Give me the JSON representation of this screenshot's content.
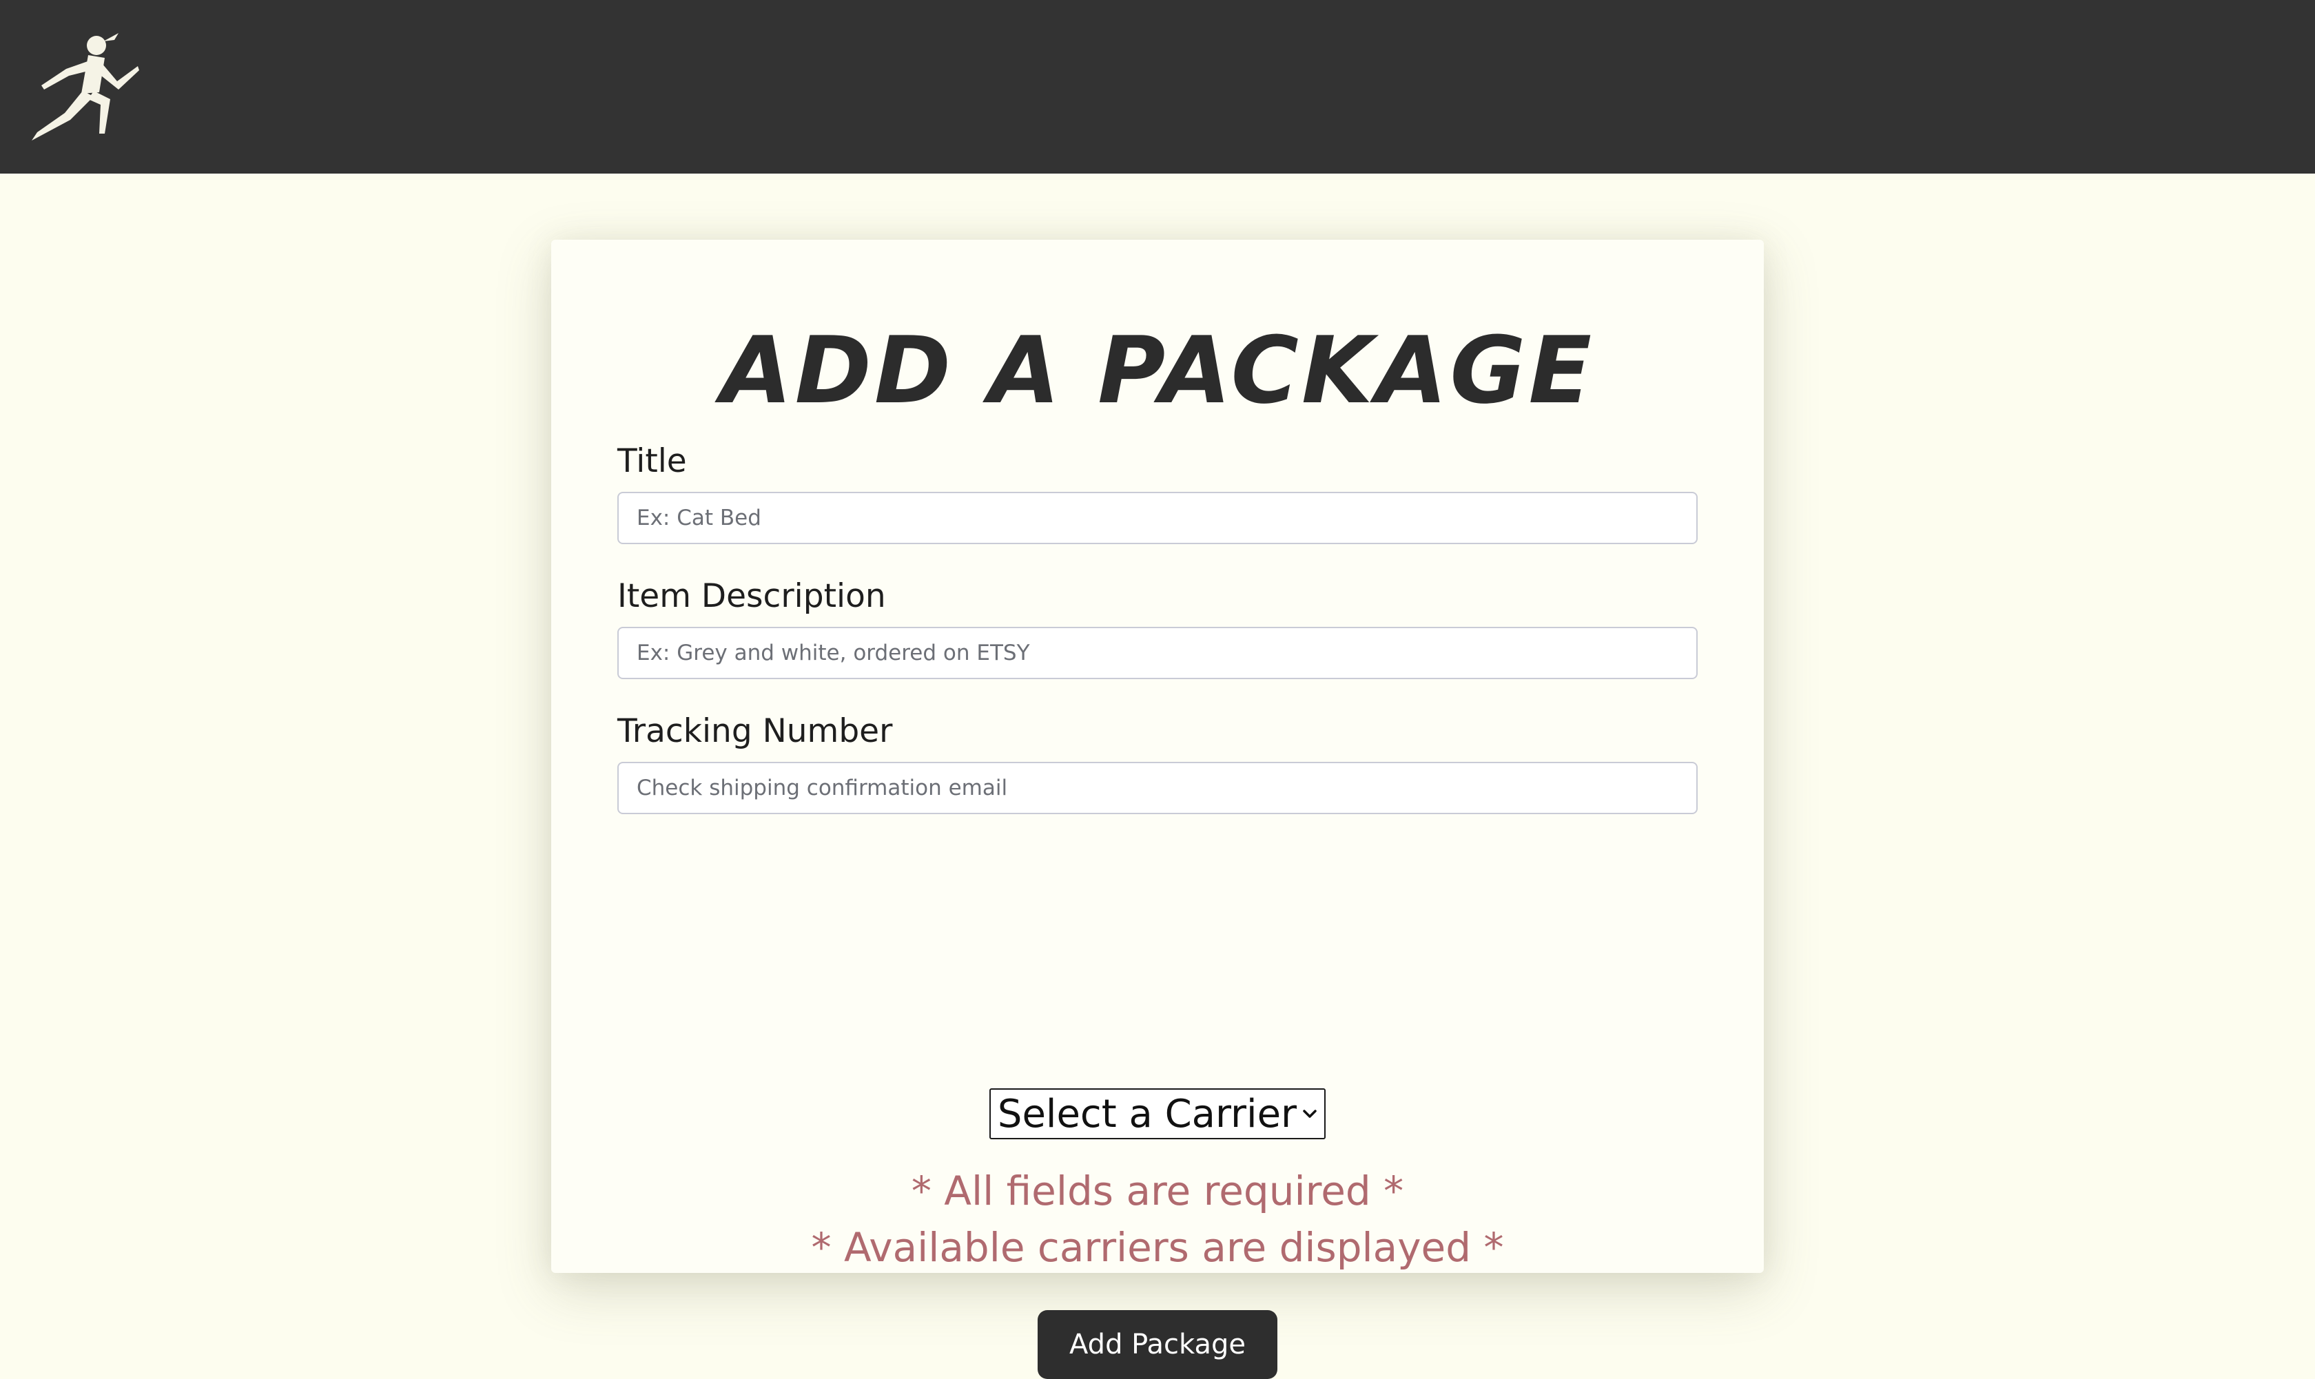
{
  "navbar": {
    "logo_icon": "running-figure-icon",
    "background": "#333333"
  },
  "form": {
    "heading": "ADD A PACKAGE",
    "title": {
      "label": "Title",
      "placeholder": "Ex: Cat Bed",
      "value": ""
    },
    "description": {
      "label": "Item Description",
      "placeholder": "Ex: Grey and white, ordered on ETSY",
      "value": ""
    },
    "tracking": {
      "label": "Tracking Number",
      "placeholder": "Check shipping confirmation email",
      "value": ""
    },
    "carrier": {
      "selected": "Select a Carrier",
      "icon": "chevron-down-icon"
    },
    "notes": {
      "required": "* All fields are required *",
      "carriers": "* Available carriers are displayed *"
    },
    "submit_label": "Add Package"
  },
  "colors": {
    "page_background": "#fdfdef",
    "card_background": "#fefef6",
    "button": "#2e2e2e",
    "note_text": "#b06a6f"
  }
}
